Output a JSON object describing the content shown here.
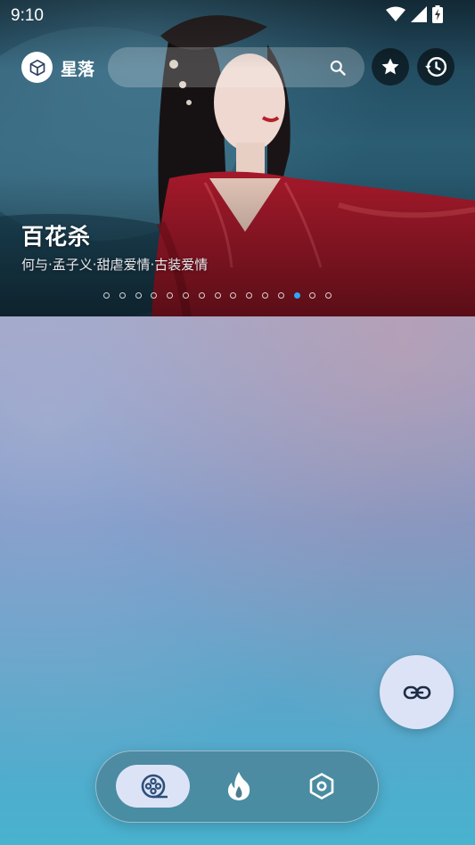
{
  "status_bar": {
    "time": "9:10",
    "icons": [
      "wifi-icon",
      "signal-icon",
      "battery-charging-icon"
    ]
  },
  "app": {
    "name": "星落",
    "logo_icon": "cube-icon"
  },
  "search": {
    "placeholder": "",
    "value": "",
    "icon": "search-icon"
  },
  "header_actions": [
    {
      "name": "favorites",
      "icon": "star-icon"
    },
    {
      "name": "history",
      "icon": "history-icon"
    }
  ],
  "banner": {
    "title": "百花杀",
    "subtitle": "何与·孟子义·甜虐爱情·古装爱情",
    "page_count": 15,
    "active_page_index": 12,
    "colors": {
      "active_dot": "#2aa7ff"
    }
  },
  "fab": {
    "icon": "link-icon"
  },
  "bottom_nav": {
    "items": [
      {
        "name": "movies",
        "icon": "film-reel-icon",
        "selected": true
      },
      {
        "name": "hot",
        "icon": "fire-icon",
        "selected": false
      },
      {
        "name": "settings",
        "icon": "hexagon-settings-icon",
        "selected": false
      }
    ],
    "colors": {
      "selected_bg": "#dde3f6",
      "selected_icon": "#2c4f7a"
    }
  }
}
